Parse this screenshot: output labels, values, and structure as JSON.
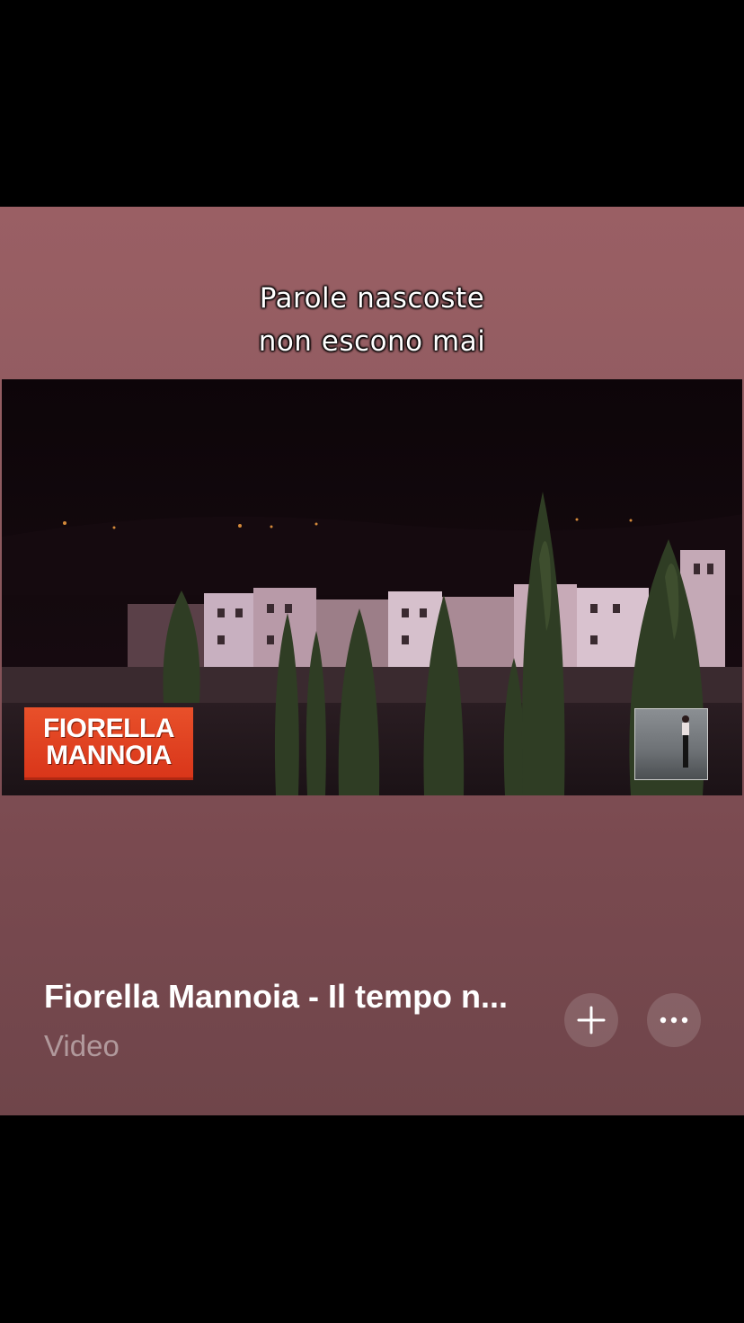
{
  "lyrics": {
    "line1": "Parole nascoste",
    "line2": "non escono mai"
  },
  "video": {
    "logo_line1": "FIORELLA",
    "logo_line2": "MANNOIA"
  },
  "track": {
    "title": "Fiorella Mannoia - Il tempo n...",
    "subtitle": "Video"
  },
  "actions": {
    "add_icon": "plus-icon",
    "more_icon": "ellipsis-icon"
  },
  "colors": {
    "card_top": "#9a5f64",
    "card_bottom": "#6f454a",
    "logo_orange": "#e8502a"
  }
}
